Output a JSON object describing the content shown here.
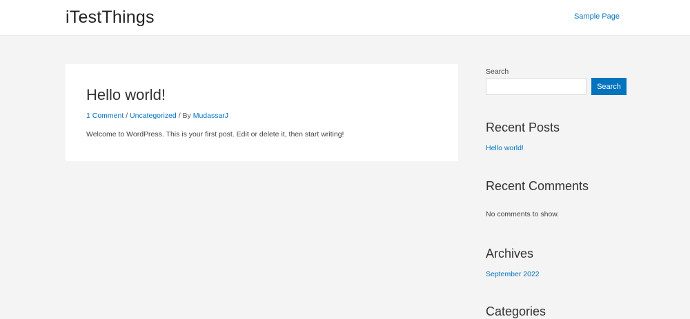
{
  "header": {
    "site_title": "iTestThings",
    "nav": [
      {
        "label": "Sample Page"
      }
    ]
  },
  "post": {
    "title": "Hello world!",
    "meta": {
      "comments": "1 Comment",
      "sep1": "/",
      "category": "Uncategorized",
      "sep2": "/ By",
      "author": "MudassarJ"
    },
    "excerpt": "Welcome to WordPress. This is your first post. Edit or delete it, then start writing!"
  },
  "sidebar": {
    "search": {
      "label": "Search",
      "placeholder": "",
      "button": "Search"
    },
    "recent_posts": {
      "title": "Recent Posts",
      "items": [
        "Hello world!"
      ]
    },
    "recent_comments": {
      "title": "Recent Comments",
      "empty": "No comments to show."
    },
    "archives": {
      "title": "Archives",
      "items": [
        "September 2022"
      ]
    },
    "categories": {
      "title": "Categories"
    }
  },
  "colors": {
    "accent": "#0274be",
    "background": "#f4f4f4",
    "card": "#ffffff"
  }
}
